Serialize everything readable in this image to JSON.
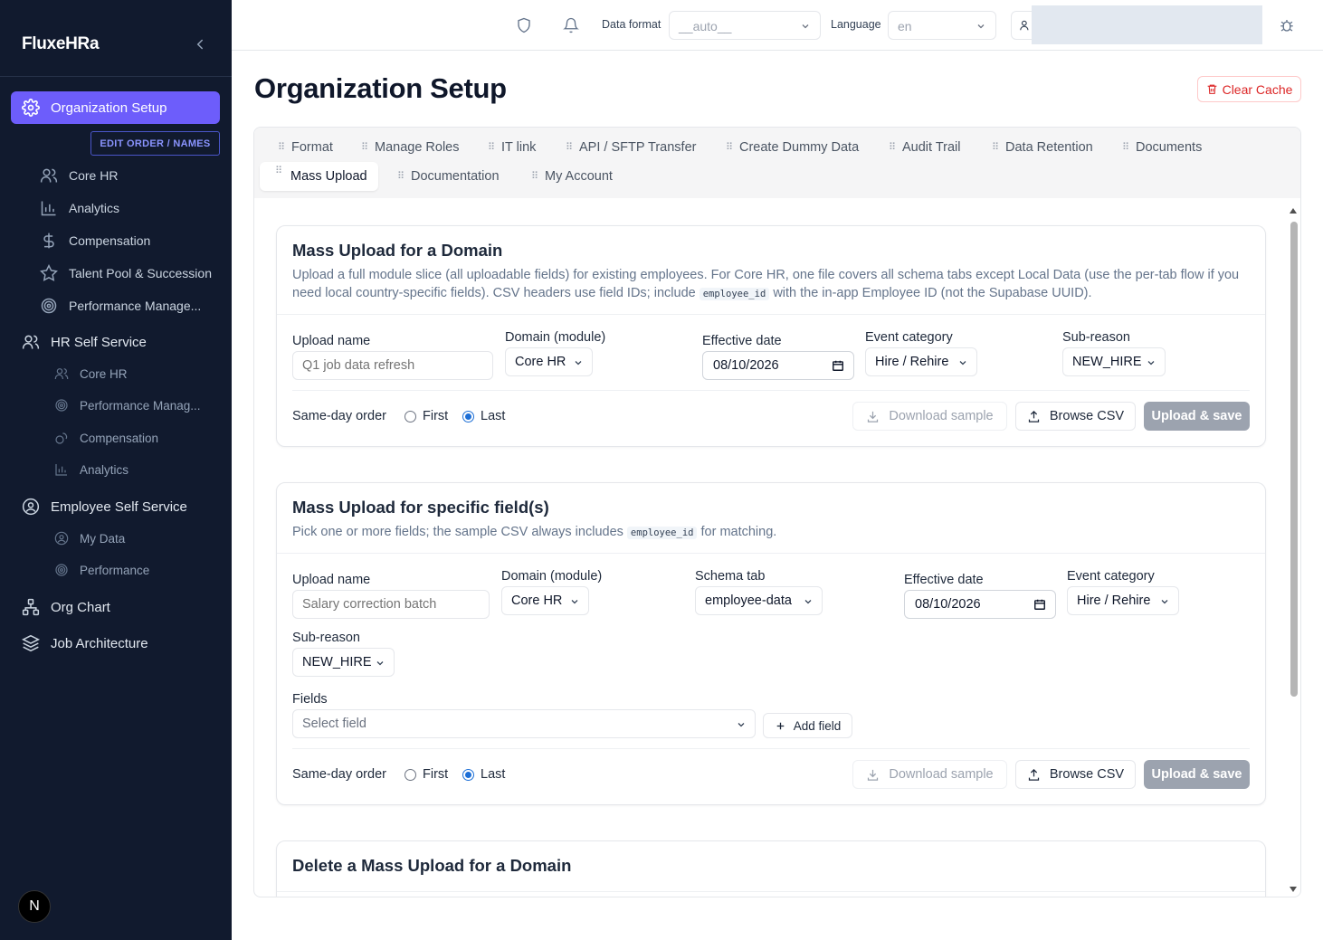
{
  "sidebar": {
    "brand": "FluxeHRa",
    "active_item": "Organization Setup",
    "edit_order_label": "EDIT ORDER / NAMES",
    "org_children": [
      {
        "label": "Core HR",
        "icon": "users-icon"
      },
      {
        "label": "Analytics",
        "icon": "bar-chart-icon"
      },
      {
        "label": "Compensation",
        "icon": "dollar-icon"
      },
      {
        "label": "Talent Pool & Succession",
        "icon": "star-icon"
      },
      {
        "label": "Performance Manage...",
        "icon": "target-icon"
      }
    ],
    "hr_self_service": {
      "label": "HR Self Service",
      "children": [
        {
          "label": "Core HR",
          "icon": "users-icon"
        },
        {
          "label": "Performance Manag...",
          "icon": "target-icon"
        },
        {
          "label": "Compensation",
          "icon": "coins-icon"
        },
        {
          "label": "Analytics",
          "icon": "bar-chart-icon"
        }
      ]
    },
    "employee_self_service": {
      "label": "Employee Self Service",
      "children": [
        {
          "label": "My Data",
          "icon": "user-circle-icon"
        },
        {
          "label": "Performance",
          "icon": "target-icon"
        }
      ]
    },
    "org_chart": "Org Chart",
    "job_architecture": "Job Architecture",
    "badge": "N"
  },
  "topbar": {
    "data_format_label": "Data format",
    "data_format_value": "__auto__",
    "language_label": "Language",
    "language_value": "en"
  },
  "page": {
    "title": "Organization Setup",
    "clear_cache": "Clear Cache"
  },
  "tabs": [
    "Format",
    "Manage Roles",
    "IT link",
    "API / SFTP Transfer",
    "Create Dummy Data",
    "Audit Trail",
    "Data Retention",
    "Documents",
    "Mass Upload",
    "Documentation",
    "My Account"
  ],
  "active_tab": "Mass Upload",
  "domain_card": {
    "title": "Mass Upload for a Domain",
    "desc_1": "Upload a full module slice (all uploadable fields) for existing employees. For Core HR, one file covers all schema tabs except Local Data (use the per-tab flow if you need local country-specific fields). CSV headers use field IDs; include",
    "desc_code": "employee_id",
    "desc_2": "with the in-app Employee ID (not the Supabase UUID).",
    "upload_name_label": "Upload name",
    "upload_name_placeholder": "Q1 job data refresh",
    "domain_label": "Domain (module)",
    "domain_value": "Core HR",
    "effective_date_label": "Effective date",
    "effective_date_value": "08/10/2026",
    "event_category_label": "Event category",
    "event_category_value": "Hire / Rehire",
    "sub_reason_label": "Sub-reason",
    "sub_reason_value": "NEW_HIRE",
    "same_day_label": "Same-day order",
    "first_label": "First",
    "last_label": "Last",
    "download_sample": "Download sample",
    "browse_csv": "Browse CSV",
    "upload_save": "Upload & save"
  },
  "fields_card": {
    "title": "Mass Upload for specific field(s)",
    "desc_1": "Pick one or more fields; the sample CSV always includes",
    "desc_code": "employee_id",
    "desc_2": "for matching.",
    "upload_name_label": "Upload name",
    "upload_name_placeholder": "Salary correction batch",
    "domain_label": "Domain (module)",
    "domain_value": "Core HR",
    "schema_tab_label": "Schema tab",
    "schema_tab_value": "employee-data",
    "effective_date_label": "Effective date",
    "effective_date_value": "08/10/2026",
    "event_category_label": "Event category",
    "event_category_value": "Hire / Rehire",
    "sub_reason_label": "Sub-reason",
    "sub_reason_value": "NEW_HIRE",
    "fields_label": "Fields",
    "fields_placeholder": "Select field",
    "add_field": "Add field",
    "same_day_label": "Same-day order",
    "first_label": "First",
    "last_label": "Last",
    "download_sample": "Download sample",
    "browse_csv": "Browse CSV",
    "upload_save": "Upload & save"
  },
  "delete_card": {
    "title": "Delete a Mass Upload for a Domain"
  },
  "colors": {
    "sidebar_bg": "#111a2e",
    "accent": "#6d5dfb",
    "danger": "#dc2626",
    "radio_selected": "#1d6fd6"
  }
}
